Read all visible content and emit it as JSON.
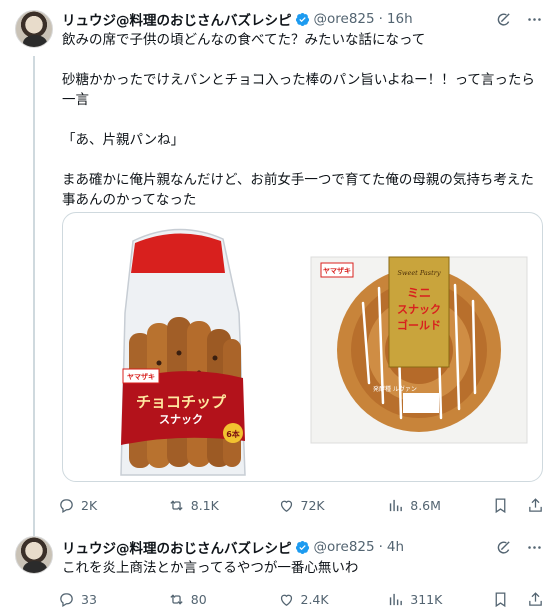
{
  "tweets": [
    {
      "author_name": "リュウジ@料理のおじさんバズレシピ",
      "handle": "@ore825",
      "separator": "·",
      "time": "16h",
      "text": "飲みの席で子供の頃どんなの食べてた？みたいな話になって\n\n砂糖かかったでけえパンとチョコ入った棒のパン旨いよねー！！って言ったら一言\n\n「あ、片親パンね」\n\nまあ確かに俺片親なんだけど、お前女手一つで育てた俺の母親の気持ち考えた事あんのかってなった",
      "media": {
        "left_product": {
          "brand": "ヤマザキ",
          "name_line1": "チョコチップ",
          "name_line2": "スナック",
          "count": "6本"
        },
        "right_product": {
          "brand": "ヤマザキ",
          "script": "Sweet Pastry",
          "name_line1": "ミニ",
          "name_line2": "スナック",
          "name_line3": "ゴールド",
          "note": "発酵種 ルヴァン"
        }
      },
      "actions": {
        "replies": "2K",
        "reposts": "8.1K",
        "likes": "72K",
        "views": "8.6M"
      }
    },
    {
      "author_name": "リュウジ@料理のおじさんバズレシピ",
      "handle": "@ore825",
      "separator": "·",
      "time": "4h",
      "text": "これを炎上商法とか言ってるやつが一番心無いわ",
      "actions": {
        "replies": "33",
        "reposts": "80",
        "likes": "2.4K",
        "views": "311K"
      }
    }
  ],
  "colors": {
    "verified": "#1d9bf0",
    "muted": "#536471",
    "border": "#cfd9de"
  },
  "icons": [
    "grok-icon",
    "more-icon",
    "reply-icon",
    "repost-icon",
    "like-icon",
    "views-icon",
    "bookmark-icon",
    "share-icon",
    "verified-badge-icon"
  ]
}
